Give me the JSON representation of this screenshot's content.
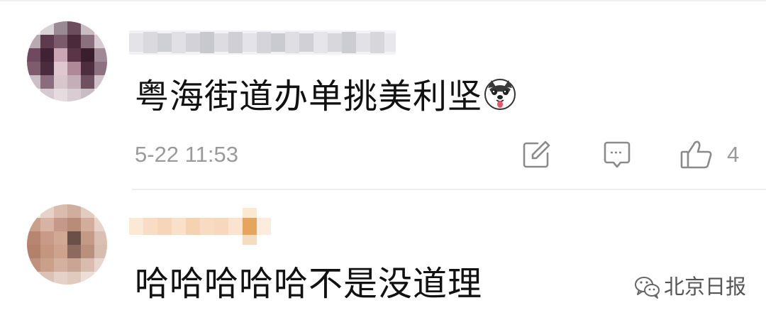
{
  "comments": [
    {
      "text": "粤海街道办单挑美利坚",
      "emoji": "husky-dog-emoji",
      "timestamp": "5-22 11:53",
      "like_count": "4"
    },
    {
      "text": "哈哈哈哈哈不是没道理"
    }
  ],
  "actions": {
    "forward_icon": "share-edit-icon",
    "reply_icon": "comment-bubble-icon",
    "like_icon": "thumbs-up-icon"
  },
  "watermark": {
    "text": "北京日报",
    "icon": "wechat-icon"
  },
  "colors": {
    "text_primary": "#111111",
    "text_secondary": "#9a9a9a",
    "divider": "#eeeeee"
  }
}
